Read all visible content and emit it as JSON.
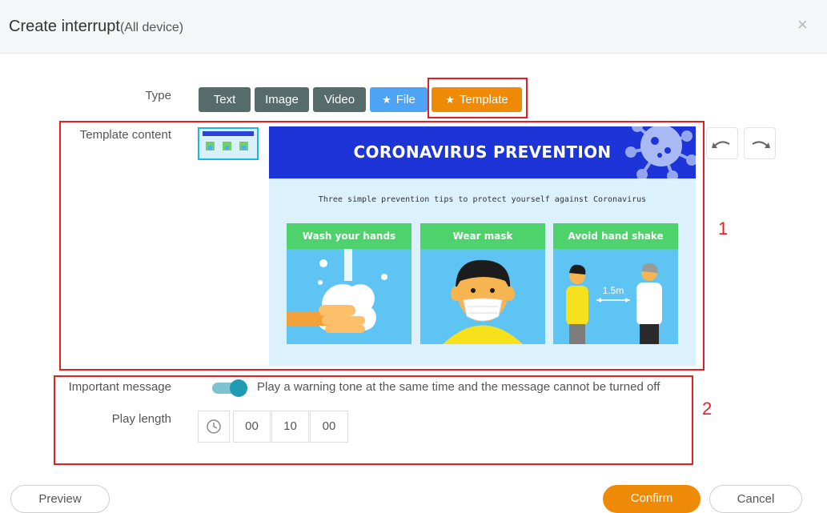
{
  "header": {
    "title": "Create interrupt",
    "title_suffix": "(All device)",
    "close_symbol": "×"
  },
  "form": {
    "type_label": "Type",
    "type_buttons": [
      {
        "label": "Text",
        "color": "#566c6b"
      },
      {
        "label": "Image",
        "color": "#566c6b"
      },
      {
        "label": "Video",
        "color": "#566c6b"
      },
      {
        "label": "File",
        "color": "#4da3f4",
        "icon": "star-icon"
      },
      {
        "label": "Template",
        "color": "#ef8a07",
        "icon": "star-icon",
        "selected": true
      }
    ],
    "template_content_label": "Template content",
    "important_message_label": "Important message",
    "important_message_on": true,
    "important_message_text": "Play a warning tone at the same time and the message cannot be turned off",
    "play_length_label": "Play length",
    "play_length": {
      "hours": "00",
      "minutes": "10",
      "seconds": "00"
    }
  },
  "template": {
    "title": "CORONAVIRUS PREVENTION",
    "subtitle": "Three simple prevention tips to protect yourself against Coronavirus",
    "cards": [
      {
        "title": "Wash your hands"
      },
      {
        "title": "Wear mask"
      },
      {
        "title": "Avoid hand shake",
        "distance": "1.5m"
      }
    ]
  },
  "annotations": {
    "one": "1",
    "two": "2"
  },
  "footer": {
    "preview": "Preview",
    "confirm": "Confirm",
    "cancel": "Cancel"
  },
  "colors": {
    "accent_orange": "#ef8a07",
    "annotation_red": "#e31f26",
    "toggle_teal": "#1f9bb3"
  }
}
